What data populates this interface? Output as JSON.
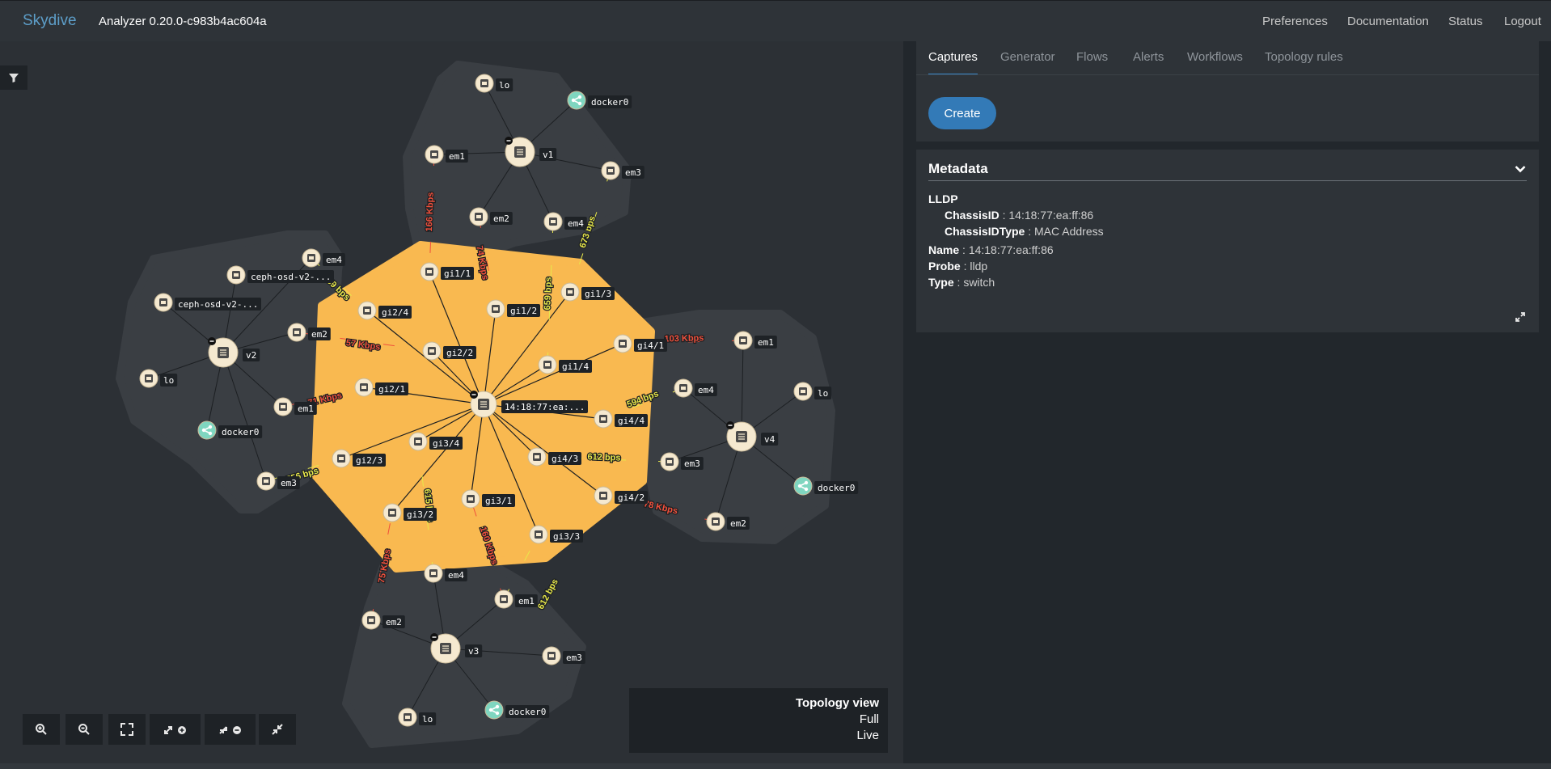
{
  "app": {
    "brand": "Skydive",
    "version": "Analyzer 0.20.0-c983b4ac604a",
    "nav": [
      "Preferences",
      "Documentation",
      "Status",
      "Logout"
    ]
  },
  "tabs": [
    "Captures",
    "Generator",
    "Flows",
    "Alerts",
    "Workflows",
    "Topology rules"
  ],
  "captures": {
    "create_label": "Create"
  },
  "metadata": {
    "title": "Metadata",
    "section": "LLDP",
    "lldp": [
      {
        "key": "ChassisID",
        "value": "14:18:77:ea:ff:86"
      },
      {
        "key": "ChassisIDType",
        "value": "MAC Address"
      }
    ],
    "fields": [
      {
        "key": "Name",
        "value": "14:18:77:ea:ff:86"
      },
      {
        "key": "Probe",
        "value": "lldp"
      },
      {
        "key": "Type",
        "value": "switch"
      }
    ]
  },
  "view": {
    "title": "Topology view",
    "mode": "Full",
    "state": "Live"
  },
  "colors": {
    "accent": "#337ab7",
    "switch_group": "#f9b950",
    "host_group": "#3a3e43",
    "node_fill": "#f5e9d0",
    "bridge_node": "#7fd6c0",
    "link_red": "#f0503c",
    "link_yellow": "#e8e84a"
  },
  "topology": {
    "switch_label": "14:18:77:ea:...",
    "switch_ports": [
      "gi1/1",
      "gi1/2",
      "gi1/3",
      "gi1/4",
      "gi2/1",
      "gi2/2",
      "gi2/3",
      "gi2/4",
      "gi3/1",
      "gi3/2",
      "gi3/3",
      "gi3/4",
      "gi4/1",
      "gi4/2",
      "gi4/3",
      "gi4/4"
    ],
    "hosts": [
      {
        "name": "v1",
        "interfaces": [
          "lo",
          "docker0",
          "em1",
          "em2",
          "em3",
          "em4"
        ]
      },
      {
        "name": "v2",
        "interfaces": [
          "em4",
          "ceph-osd-v2-...",
          "ceph-osd-v2-...",
          "em2",
          "lo",
          "em1",
          "docker0",
          "em3"
        ]
      },
      {
        "name": "v3",
        "interfaces": [
          "em4",
          "em1",
          "em2",
          "em3",
          "lo",
          "docker0"
        ]
      },
      {
        "name": "v4",
        "interfaces": [
          "em1",
          "em4",
          "lo",
          "em3",
          "em2",
          "docker0"
        ]
      }
    ],
    "link_labels": [
      "166 Kbps",
      "74 Kbps",
      "659 bps",
      "673 bps",
      "59 bps",
      "57 Kbps",
      "71 Kbps",
      "556 bps",
      "103 Kbps",
      "594 bps",
      "612 bps",
      "78 Kbps",
      "612 bps",
      "160 Kbps",
      "615 bps",
      "75 Kbps"
    ]
  }
}
